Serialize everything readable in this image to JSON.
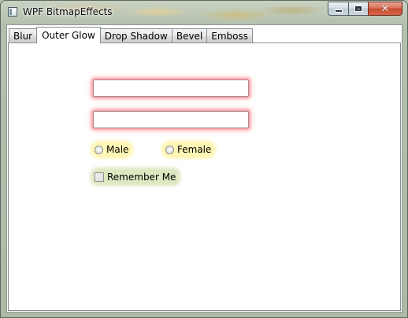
{
  "window": {
    "title": "WPF BitmapEffects"
  },
  "caption_buttons": {
    "minimize_icon": "minimize-icon",
    "maximize_icon": "maximize-icon",
    "close_icon": "close-icon",
    "close_glyph": "✕"
  },
  "tabs": [
    {
      "label": "Blur"
    },
    {
      "label": "Outer Glow"
    },
    {
      "label": "Drop Shadow"
    },
    {
      "label": "Bevel"
    },
    {
      "label": "Emboss"
    }
  ],
  "selected_tab": "Outer Glow",
  "form": {
    "text1": {
      "value": "",
      "placeholder": ""
    },
    "text2": {
      "value": "",
      "placeholder": ""
    },
    "radio_male": {
      "label": "Male",
      "checked": false
    },
    "radio_female": {
      "label": "Female",
      "checked": false
    },
    "remember": {
      "label": "Remember Me",
      "checked": false
    }
  },
  "colors": {
    "textbox_glow": "#ff828c",
    "radio_glow": "#ffeb64",
    "checkbox_glow": "#afc86e",
    "close_button": "#c64b2e"
  }
}
